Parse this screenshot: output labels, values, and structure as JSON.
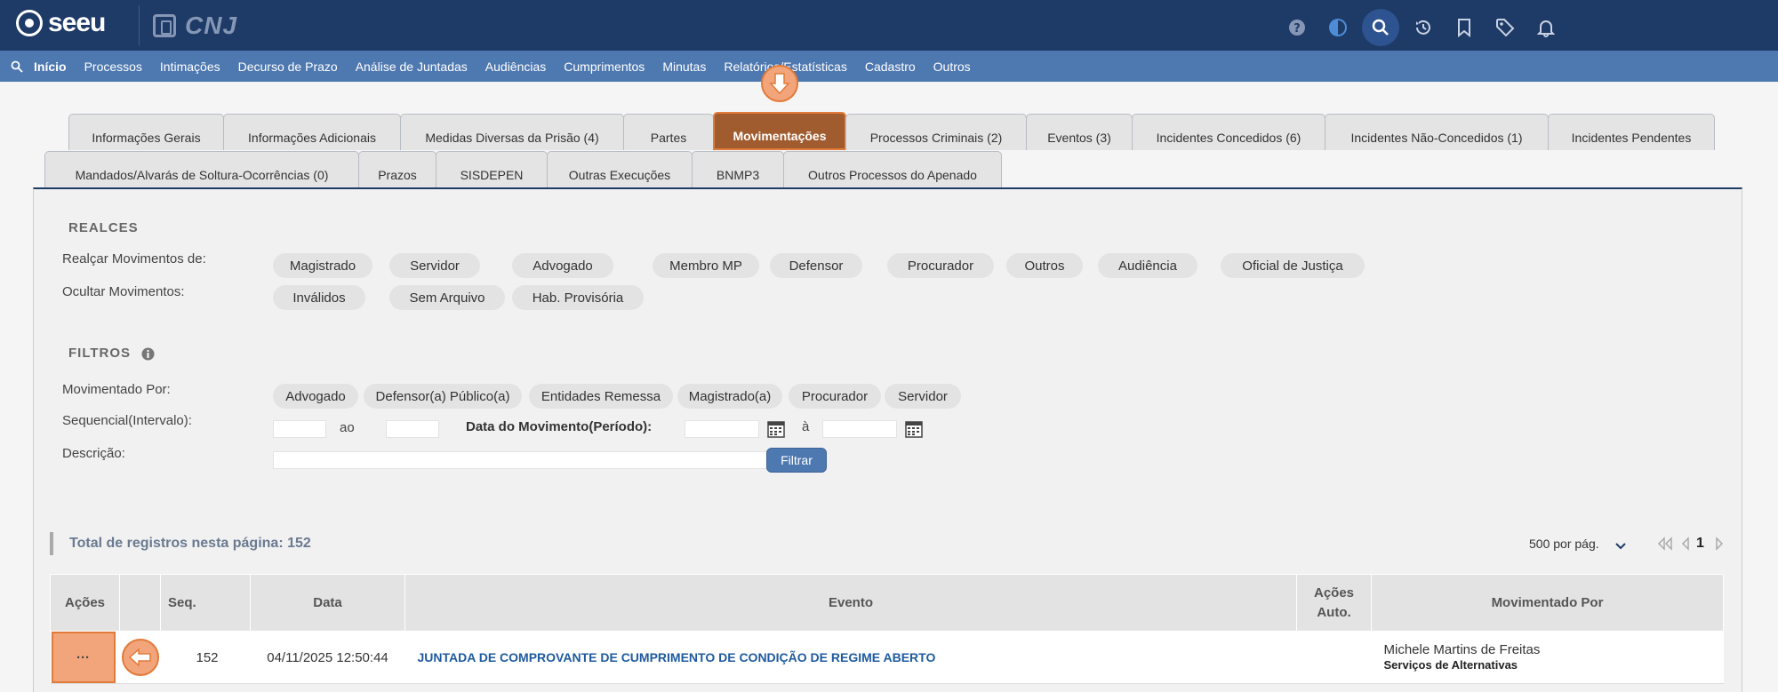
{
  "app": {
    "logo_text": "seeu",
    "partner_logo": "CNJ"
  },
  "top_icons": [
    {
      "name": "help-icon"
    },
    {
      "name": "theme-icon"
    },
    {
      "name": "search-icon"
    },
    {
      "name": "history-icon"
    },
    {
      "name": "bookmark-icon"
    },
    {
      "name": "tag-icon"
    },
    {
      "name": "bell-icon"
    }
  ],
  "nav": {
    "items": [
      "Início",
      "Processos",
      "Intimações",
      "Decurso de Prazo",
      "Análise de Juntadas",
      "Audiências",
      "Cumprimentos",
      "Minutas",
      "Relatórios/Estatísticas",
      "Cadastro",
      "Outros"
    ]
  },
  "tabs_row1": [
    "Informações Gerais",
    "Informações Adicionais",
    "Medidas Diversas da Prisão (4)",
    "Partes",
    "Movimentações",
    "Processos Criminais (2)",
    "Eventos (3)",
    "Incidentes Concedidos (6)",
    "Incidentes Não-Concedidos (1)",
    "Incidentes Pendentes"
  ],
  "tabs_row2": [
    "Mandados/Alvarás de Soltura-Ocorrências (0)",
    "Prazos",
    "SISDEPEN",
    "Outras Execuções",
    "BNMP3",
    "Outros Processos do Apenado"
  ],
  "active_tab": "Movimentações",
  "realces": {
    "title": "REALCES",
    "realcar_label": "Realçar Movimentos de:",
    "realcar_chips": [
      "Magistrado",
      "Servidor",
      "Advogado",
      "Membro MP",
      "Defensor",
      "Procurador",
      "Outros",
      "Audiência",
      "Oficial de Justiça"
    ],
    "ocultar_label": "Ocultar Movimentos:",
    "ocultar_chips": [
      "Inválidos",
      "Sem Arquivo",
      "Hab. Provisória"
    ]
  },
  "filtros": {
    "title": "FILTROS",
    "movimentado_label": "Movimentado Por:",
    "movimentado_chips": [
      "Advogado",
      "Defensor(a) Público(a)",
      "Entidades Remessa",
      "Magistrado(a)",
      "Procurador",
      "Servidor"
    ],
    "sequencial_label": "Sequencial(Intervalo):",
    "ao": "ao",
    "data_label": "Data do Movimento(Período):",
    "a": "à",
    "descricao_label": "Descrição:",
    "filtrar_button": "Filtrar"
  },
  "results": {
    "total_text": "Total de registros nesta página: 152",
    "per_page": "500 por pág.",
    "current_page": "1"
  },
  "table": {
    "headers": {
      "acoes": "Ações",
      "seq": "Seq.",
      "data": "Data",
      "evento": "Evento",
      "acoes_auto_1": "Ações",
      "acoes_auto_2": "Auto.",
      "movimentado_por": "Movimentado Por"
    },
    "rows": [
      {
        "acoes": "···",
        "seq": "152",
        "data": "04/11/2025 12:50:44",
        "evento": "JUNTADA DE COMPROVANTE DE CUMPRIMENTO DE CONDIÇÃO DE REGIME ABERTO",
        "movimentado_nome": "Michele Martins de Freitas",
        "movimentado_orgao": "Serviços de Alternativas"
      }
    ]
  },
  "colors": {
    "topbar": "#1e3a66",
    "navbar": "#4e78b0",
    "highlight": "#e17b3a",
    "link": "#1e5aa0"
  }
}
